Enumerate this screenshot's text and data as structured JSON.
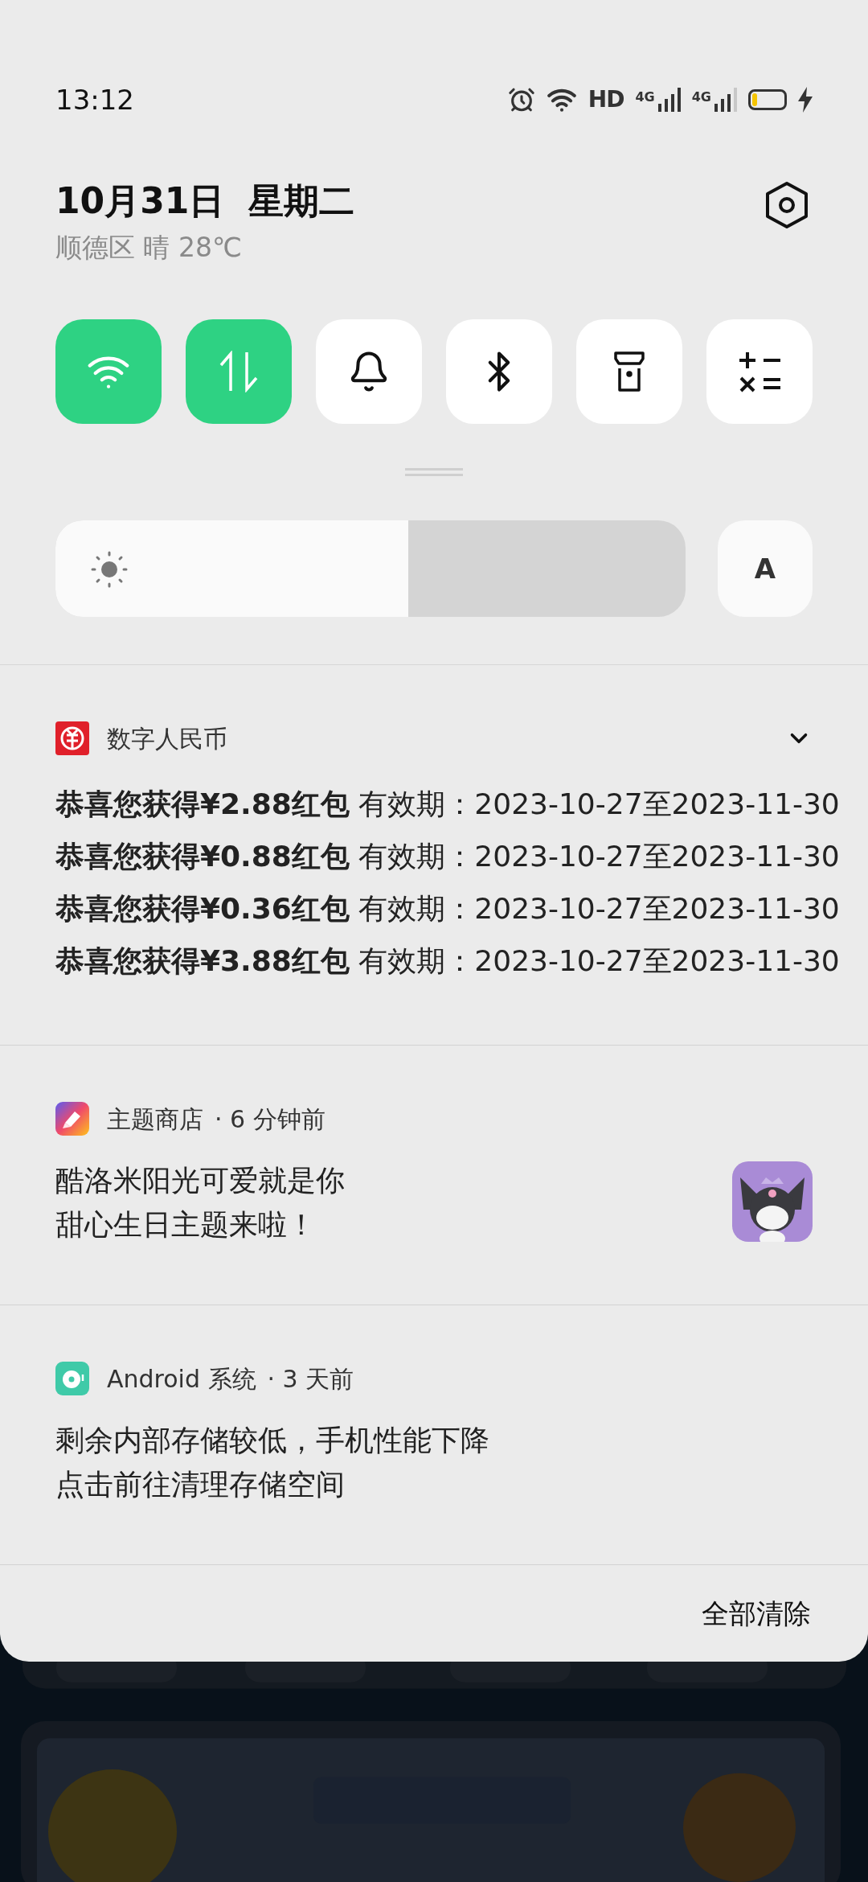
{
  "status_bar": {
    "time": "13:12",
    "hd_label": "HD",
    "network_labels": [
      "4G",
      "4G"
    ],
    "charging": true
  },
  "header": {
    "date": "10月31日",
    "weekday": "星期二",
    "weather": "顺德区 晴 28℃"
  },
  "toggles": [
    {
      "kind": "wifi",
      "selected": true
    },
    {
      "kind": "data",
      "selected": true
    },
    {
      "kind": "bell",
      "selected": false
    },
    {
      "kind": "bluetooth",
      "selected": false
    },
    {
      "kind": "flashlight",
      "selected": false
    },
    {
      "kind": "calculator",
      "selected": false
    }
  ],
  "brightness": {
    "level": 0.56,
    "auto_label": "A"
  },
  "notifications": [
    {
      "kind": "wallet",
      "app": "数字人民币",
      "expandable": true,
      "lines": [
        "**恭喜您获得¥2.88红包** 有效期：2023-10-27至2023-11-30",
        "**恭喜您获得¥0.88红包** 有效期：2023-10-27至2023-11-30",
        "**恭喜您获得¥0.36红包** 有效期：2023-10-27至2023-11-30",
        "**恭喜您获得¥3.88红包** 有效期：2023-10-27至2023-11-30"
      ]
    },
    {
      "kind": "theme",
      "app": "主题商店",
      "time": "· 6 分钟前",
      "thumbnail": true,
      "lines": [
        "酷洛米阳光可爱就是你",
        "甜心生日主题来啦！"
      ]
    },
    {
      "kind": "system",
      "app": "Android 系统",
      "time": "· 3 天前",
      "lines": [
        "剩余内部存储较低，手机性能下降",
        "点击前往清理存储空间"
      ]
    }
  ],
  "clear_all": "全部清除"
}
